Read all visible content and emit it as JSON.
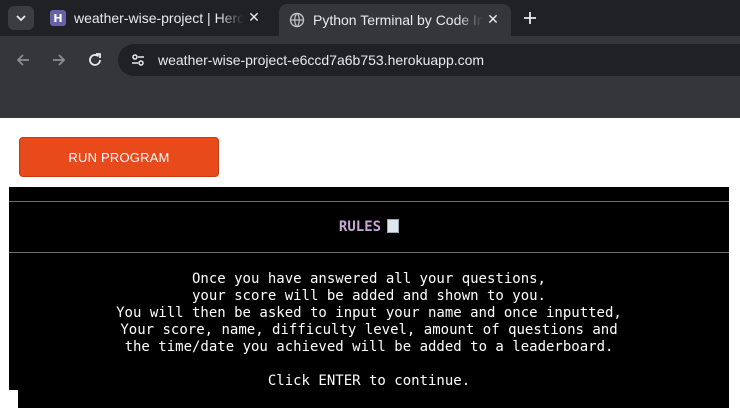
{
  "browser": {
    "tabs": [
      {
        "title": "weather-wise-project | Heroku",
        "favicon": "heroku-icon",
        "active": false
      },
      {
        "title": "Python Terminal by Code Institute",
        "favicon": "globe-icon",
        "active": true
      }
    ],
    "tab_search_icon": "chevron-down-icon",
    "new_tab_icon": "plus-icon",
    "url": "weather-wise-project-e6ccd7a6b753.herokuapp.com",
    "site_info_icon": "tune-icon"
  },
  "page": {
    "run_button_label": "RUN PROGRAM",
    "terminal": {
      "heading": "RULES",
      "heading_icon": "scroll-icon",
      "lines": [
        "Once you have answered all your questions,",
        "your score will be added and shown to you.",
        "You will then be asked to input your name and once inputted,",
        "Your score, name, difficulty level, amount of questions and",
        "the time/date you achieved will be added to a leaderboard."
      ],
      "prompt": "Click ENTER to continue."
    }
  },
  "colors": {
    "run_button": "#e84a1b",
    "terminal_bg": "#000000",
    "heading": "#c8a6d6",
    "browser_dark": "#202124"
  }
}
